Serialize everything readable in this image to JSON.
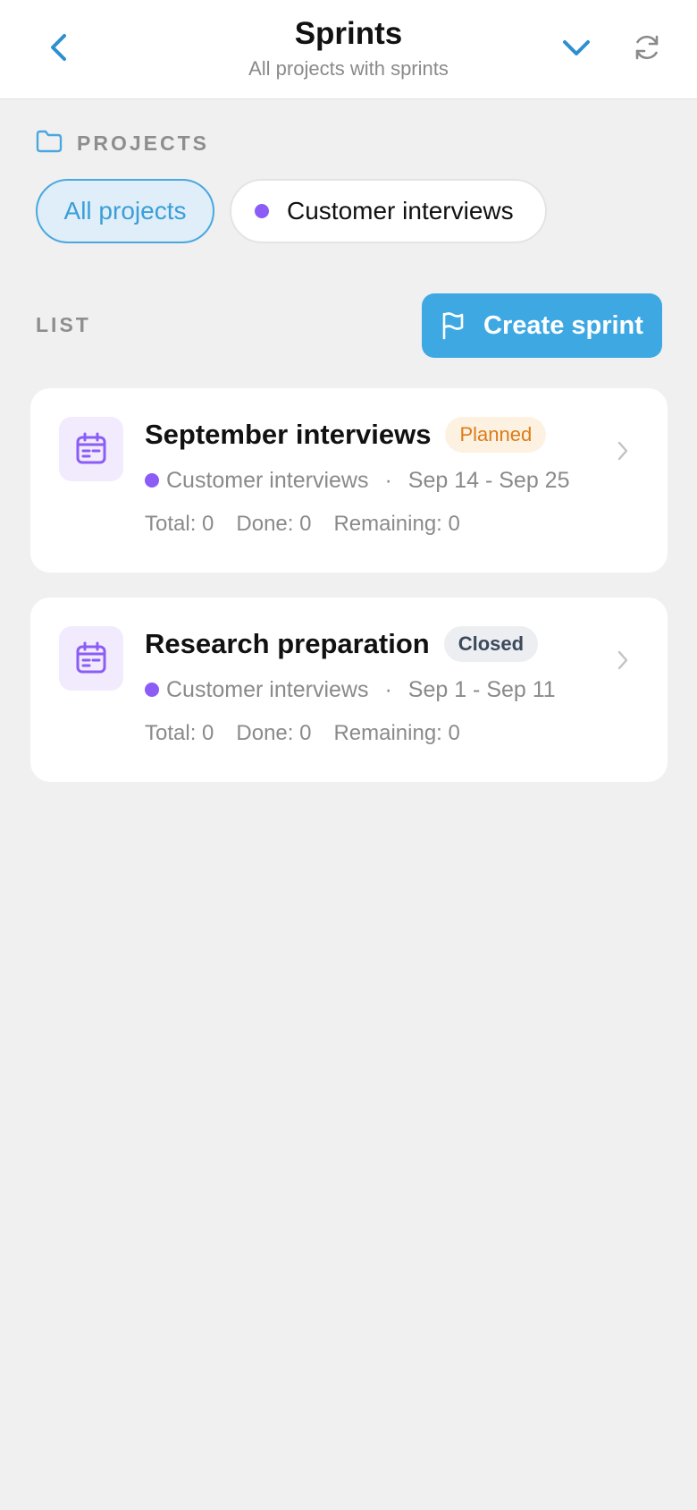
{
  "header": {
    "title": "Sprints",
    "subtitle": "All projects with sprints",
    "back_icon": "chevron-left-icon",
    "dropdown_icon": "chevron-down-icon",
    "refresh_icon": "refresh-icon"
  },
  "projects": {
    "label": "PROJECTS",
    "icon": "folder-icon",
    "chips": [
      {
        "label": "All projects",
        "selected": true
      },
      {
        "label": "Customer interviews",
        "selected": false,
        "dot_color": "#8b5cf6"
      }
    ]
  },
  "list": {
    "label": "LIST",
    "create_button": "Create sprint",
    "create_icon": "flag-icon"
  },
  "sprints": [
    {
      "title": "September interviews",
      "status": "Planned",
      "project": "Customer interviews",
      "separator": "·",
      "dates": "Sep 14 - Sep 25",
      "total": "Total: 0",
      "done": "Done: 0",
      "remaining": "Remaining: 0"
    },
    {
      "title": "Research preparation",
      "status": "Closed",
      "project": "Customer interviews",
      "separator": "·",
      "dates": "Sep 1 - Sep 11",
      "total": "Total: 0",
      "done": "Done: 0",
      "remaining": "Remaining: 0"
    }
  ],
  "colors": {
    "accent": "#3ea8e3",
    "project_dot": "#8b5cf6",
    "planned": "#dc7c16",
    "closed": "#3d4a5c",
    "background": "#f0f0f0"
  }
}
